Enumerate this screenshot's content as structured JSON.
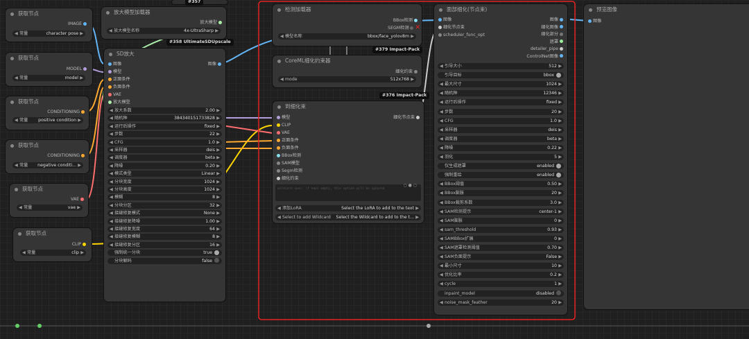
{
  "colors": {
    "image": "#64b5f6",
    "model": "#b39ddb",
    "conditioning": "#ffa931",
    "vae": "#ff6e6e",
    "clip": "#ffd500",
    "upscale": "#aaeeaa",
    "selection": "#e62222"
  },
  "get_nodes": [
    {
      "title": "获取节点",
      "out": "IMAGE",
      "label": "常量",
      "value": "character pose"
    },
    {
      "title": "获取节点",
      "out": "MODEL",
      "label": "常量",
      "value": "model"
    },
    {
      "title": "获取节点",
      "out": "CONDITIONING",
      "label": "常量",
      "value": "positive condition"
    },
    {
      "title": "获取节点",
      "out": "CONDITIONING",
      "label": "常量",
      "value": "negative conditi..."
    },
    {
      "title": "获取节点",
      "out": "VAE",
      "label": "常量",
      "value": "vae"
    },
    {
      "title": "获取节点",
      "out": "CLIP",
      "label": "常量",
      "value": "clip"
    }
  ],
  "top_tag": "#357",
  "upscaler": {
    "title": "放大模型加载器",
    "out": "放大模型",
    "w_label": "放大模型名称",
    "w_value": "4x-UltraSharp",
    "tag": "#358 UltimateSDUpscale"
  },
  "sd_upscale": {
    "title": "SD放大",
    "inputs": [
      "图像",
      "模型",
      "正面条件",
      "负面条件",
      "VAE",
      "放大模型"
    ],
    "output": "图像",
    "widgets": [
      [
        "放大系数",
        "2.00"
      ],
      [
        "随机种",
        "384340151733828"
      ],
      [
        "运行后操作",
        "fixed"
      ],
      [
        "步数",
        "22"
      ],
      [
        "CFG",
        "1.0"
      ],
      [
        "采样器",
        "deis"
      ],
      [
        "调度器",
        "beta"
      ],
      [
        "降噪",
        "0.20"
      ],
      [
        "模式类型",
        "Linear"
      ],
      [
        "分块宽度",
        "1024"
      ],
      [
        "分块高度",
        "1024"
      ],
      [
        "模糊",
        "8"
      ],
      [
        "分块分区",
        "32"
      ],
      [
        "接缝修复模式",
        "None"
      ],
      [
        "接缝修复降噪",
        "1.00"
      ],
      [
        "接缝修复宽度",
        "64"
      ],
      [
        "接缝修复模糊",
        "8"
      ],
      [
        "接缝修复分区",
        "16"
      ]
    ],
    "toggles": [
      [
        "强制统一分块",
        "true"
      ],
      [
        "分块解码",
        "false"
      ]
    ]
  },
  "detector": {
    "title": "检测加载器",
    "outs": [
      "BBox检测",
      "SEGM检测"
    ],
    "w_label": "模型名称",
    "w_value": "bbox/face_yolov8m",
    "tag": "#379 Impact-Pack"
  },
  "coreml": {
    "title": "CoreML细化约束器",
    "out": "细化约束",
    "w_label": "mode",
    "w_value": "512x768",
    "tag": "#376 Impact-Pack"
  },
  "to_detailer": {
    "title": "到细化束",
    "inputs": [
      "模型",
      "CLIP",
      "VAE",
      "正面条件",
      "负面条件",
      "BBox检测",
      "SAM模型",
      "Segm检测",
      "细化约束"
    ],
    "output": "细化节点束",
    "text_placeholder": "wildcard spec: if kept empty, this option will be ignored",
    "widgets": [
      [
        "添加LoRA",
        "Select the LoRA to add to the text"
      ],
      [
        "Select to add Wildcard",
        "Select the Wildcard to add to the t..."
      ]
    ]
  },
  "face_detailer": {
    "title": "面部细化(节点束)",
    "inputs": [
      "图像",
      "细化节点束",
      "scheduler_func_opt"
    ],
    "outputs": [
      "图像",
      "细化图像",
      "细化部分",
      "遮罩",
      "detailer_pipe",
      "ControlNet图像"
    ],
    "widgets": [
      [
        "引导大小",
        "512"
      ],
      [
        "引导目标",
        "bbox",
        "toggle"
      ],
      [
        "最大尺寸",
        "1024"
      ],
      [
        "随机种",
        "12346"
      ],
      [
        "运行后操作",
        "fixed"
      ],
      [
        "步数",
        "20"
      ],
      [
        "CFG",
        "1.0"
      ],
      [
        "采样器",
        "deis"
      ],
      [
        "调度器",
        "beta"
      ],
      [
        "降噪",
        "0.22"
      ],
      [
        "羽化",
        "5"
      ],
      [
        "仅生成遮罩",
        "enabled",
        "toggle"
      ],
      [
        "强制重绘",
        "enabled",
        "toggle"
      ],
      [
        "BBox阈值",
        "0.50"
      ],
      [
        "BBox膨胀",
        "20"
      ],
      [
        "BBox裁剪系数",
        "3.0"
      ],
      [
        "SAM检测提示",
        "center-1"
      ],
      [
        "SAM膨胀",
        "0"
      ],
      [
        "sam_threshold",
        "0.93"
      ],
      [
        "SAMBBox扩展",
        "0"
      ],
      [
        "SAM遮罩检测阈值",
        "0.70"
      ],
      [
        "SAM负面提示",
        "False"
      ],
      [
        "最小尺寸",
        "10"
      ],
      [
        "优化比率",
        "0.2"
      ],
      [
        "cycle",
        "1"
      ],
      [
        "inpaint_model",
        "disabled",
        "toggle-off"
      ],
      [
        "noise_mask_feather",
        "20"
      ]
    ]
  },
  "preview": {
    "title": "预览图像",
    "input": "图像"
  }
}
